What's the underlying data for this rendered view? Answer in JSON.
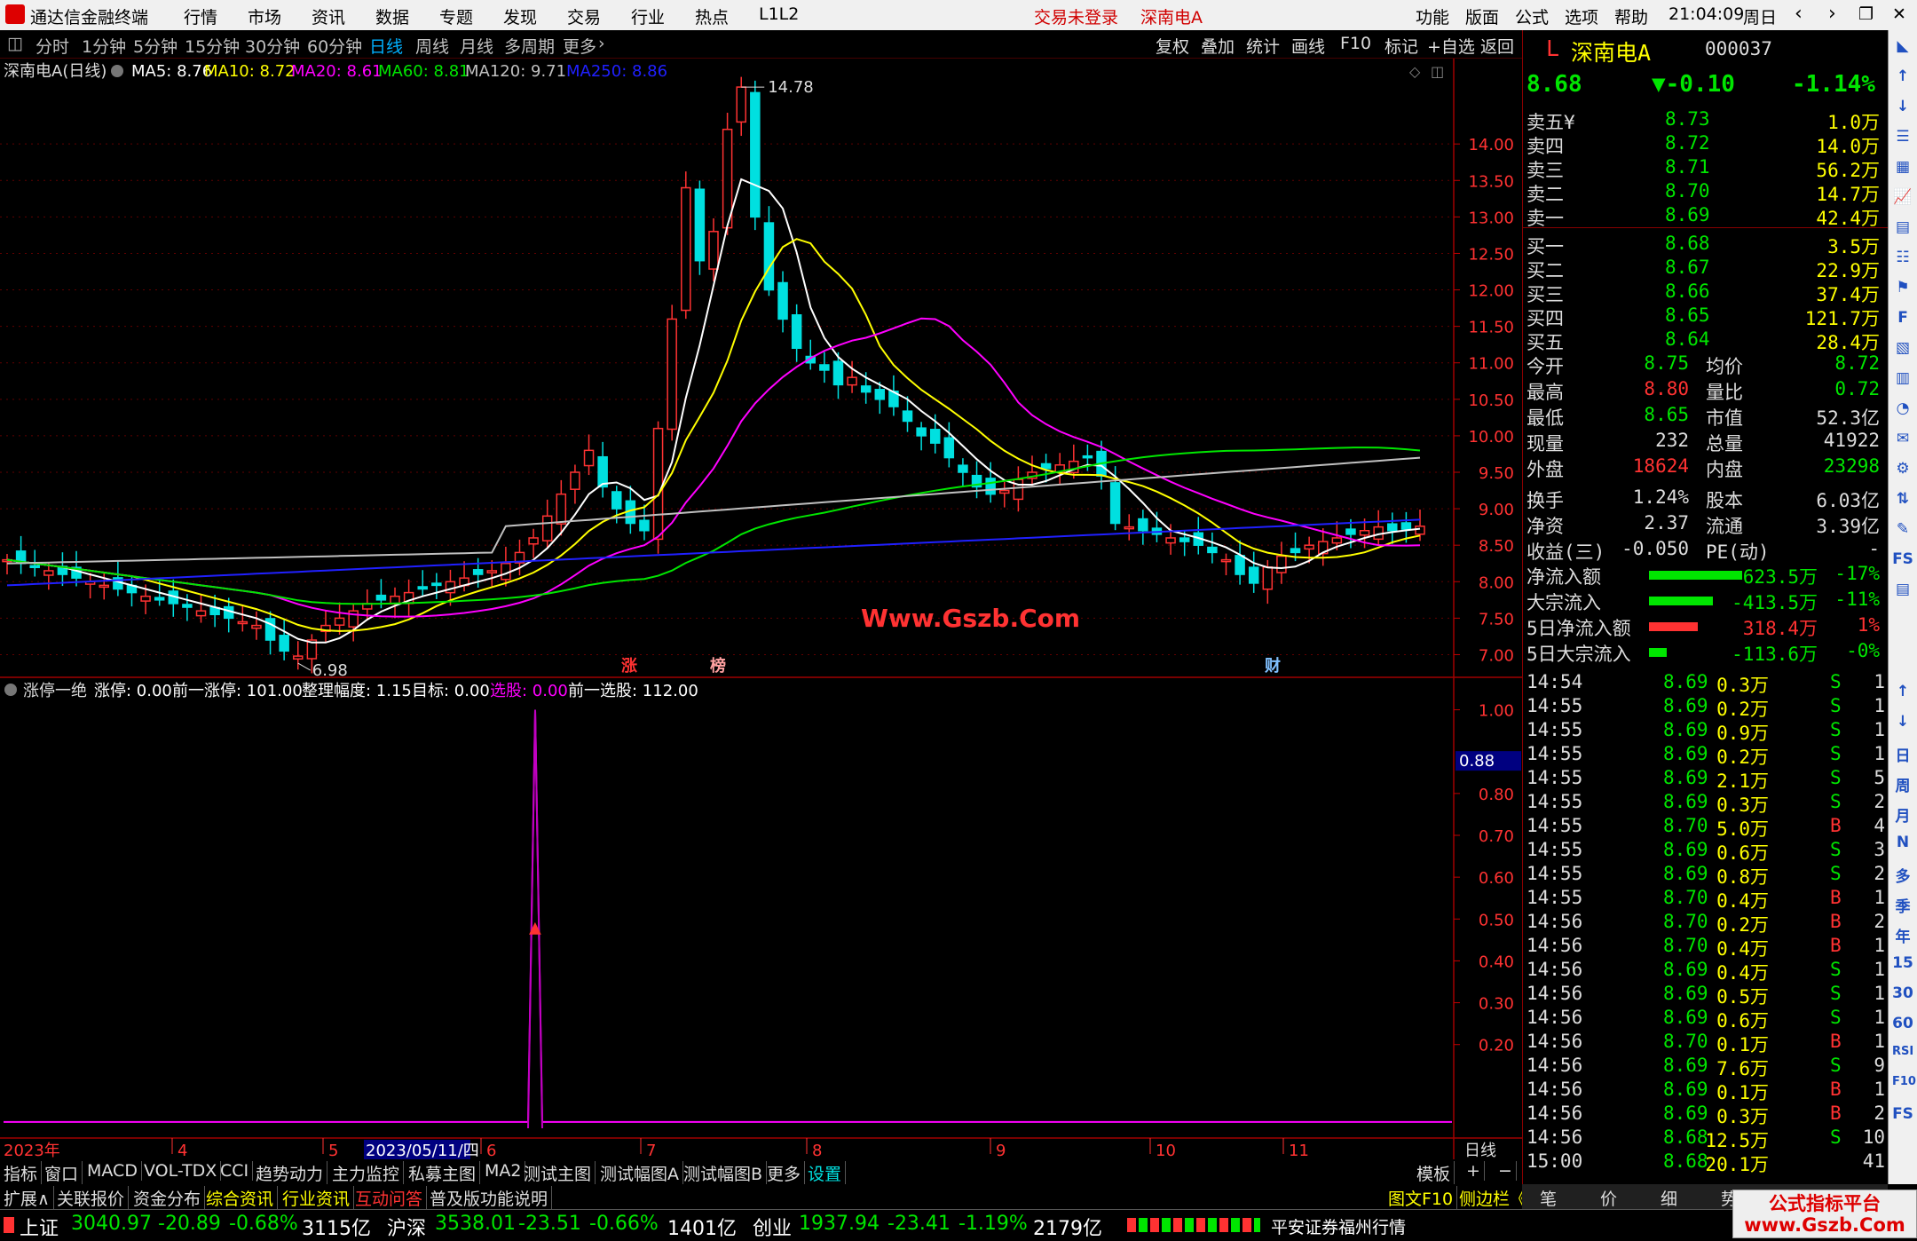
{
  "app": {
    "title": "通达信金融终端",
    "menus": [
      "行情",
      "市场",
      "资讯",
      "数据",
      "专题",
      "发现",
      "交易",
      "行业",
      "热点",
      "L1L2"
    ],
    "login": "交易未登录",
    "stock_tag": "深南电A",
    "right_menus": [
      "功能",
      "版面",
      "公式",
      "选项",
      "帮助"
    ],
    "time": "21:04:09",
    "weekday": "周日"
  },
  "periods": [
    "分时",
    "1分钟",
    "5分钟",
    "15分钟",
    "30分钟",
    "60分钟",
    "日线",
    "周线",
    "月线",
    "多周期",
    "更多"
  ],
  "active_period": "日线",
  "tools": [
    "复权",
    "叠加",
    "统计",
    "画线",
    "F10",
    "标记",
    "+自选",
    "返回"
  ],
  "ma_legend": {
    "title": "深南电A(日线)",
    "items": [
      {
        "label": "MA5: 8.76",
        "color": "#ffffff"
      },
      {
        "label": "MA10: 8.72",
        "color": "#ffff00"
      },
      {
        "label": "MA20: 8.61",
        "color": "#ff00ff"
      },
      {
        "label": "MA60: 8.81",
        "color": "#00e600"
      },
      {
        "label": "MA120: 9.71",
        "color": "#c0c0c0"
      },
      {
        "label": "MA250: 8.86",
        "color": "#2020ff"
      }
    ]
  },
  "watermark": "Www.Gszb.Com",
  "markers": [
    "涨",
    "榜",
    "财"
  ],
  "high_label": "14.78",
  "low_label": "6.98",
  "indicator_legend": {
    "name": "涨停一绝",
    "items": [
      {
        "label": "涨停: 0.00",
        "color": "#ffffff"
      },
      {
        "label": "前一涨停: 101.00",
        "color": "#ffffff"
      },
      {
        "label": "整理幅度: 1.15",
        "color": "#ffffff"
      },
      {
        "label": "目标: 0.00",
        "color": "#ffffff"
      },
      {
        "label": "选股: 0.00",
        "color": "#ff00ff"
      },
      {
        "label": "前一选股: 112.00",
        "color": "#ffffff"
      }
    ]
  },
  "current_value_tag": "0.88",
  "date_axis": {
    "labels": [
      "2023年",
      "4",
      "5",
      "2023/05/11/四",
      "6",
      "7",
      "8",
      "9",
      "10",
      "11"
    ],
    "right": "日线"
  },
  "chart_data": {
    "type": "candlestick",
    "price_axis": {
      "ticks": [
        "14.00",
        "13.50",
        "13.00",
        "12.50",
        "12.00",
        "11.50",
        "11.00",
        "10.50",
        "10.00",
        "9.50",
        "9.00",
        "8.50",
        "8.00",
        "7.50",
        "7.00"
      ],
      "ylim": [
        6.75,
        15.0
      ]
    },
    "indicator_axis": {
      "ticks": [
        "1.00",
        "0.80",
        "0.70",
        "0.60",
        "0.50",
        "0.40",
        "0.30",
        "0.20"
      ]
    },
    "daily_close": [
      8.3,
      8.25,
      8.2,
      8.15,
      8.1,
      8.05,
      8.0,
      7.95,
      7.9,
      7.85,
      7.8,
      7.75,
      7.7,
      7.65,
      7.6,
      7.55,
      7.5,
      7.45,
      7.4,
      7.2,
      7.05,
      6.98,
      7.2,
      7.4,
      7.5,
      7.6,
      7.7,
      7.75,
      7.8,
      7.85,
      7.9,
      7.95,
      8.0,
      8.05,
      8.1,
      8.15,
      8.25,
      8.4,
      8.6,
      8.9,
      9.2,
      9.5,
      9.8,
      9.3,
      9.0,
      8.8,
      8.7,
      10.1,
      11.6,
      13.4,
      12.4,
      12.8,
      14.2,
      14.78,
      13.0,
      12.0,
      11.6,
      11.2,
      11.0,
      10.9,
      10.7,
      10.8,
      10.6,
      10.5,
      10.4,
      10.2,
      10.0,
      9.9,
      9.7,
      9.5,
      9.3,
      9.2,
      9.25,
      9.4,
      9.5,
      9.55,
      9.6,
      9.65,
      9.7,
      9.45,
      8.8,
      8.75,
      8.7,
      8.65,
      8.6,
      8.55,
      8.5,
      8.4,
      8.3,
      8.1,
      7.98,
      8.2,
      8.35,
      8.4,
      8.5,
      8.55,
      8.6,
      8.65,
      8.7,
      8.75,
      8.7,
      8.72,
      8.76
    ],
    "series": [
      {
        "name": "MA5",
        "color": "#ffffff"
      },
      {
        "name": "MA10",
        "color": "#ffff00"
      },
      {
        "name": "MA20",
        "color": "#ff00ff"
      },
      {
        "name": "MA60",
        "color": "#00e600"
      },
      {
        "name": "MA120",
        "color": "#c0c0c0"
      },
      {
        "name": "MA250",
        "color": "#2020ff"
      }
    ],
    "indicator_spike": {
      "value": 1.0,
      "arrow_value": 0.48,
      "date_label": "2023/05/11/四"
    }
  },
  "quote": {
    "code_prefix": "L",
    "name": "深南电A",
    "code": "000037",
    "price": "8.68",
    "change": "▼-0.10",
    "pct": "-1.14%",
    "asks": [
      {
        "label": "卖五",
        "p": "8.73",
        "v": "1.0万"
      },
      {
        "label": "卖四",
        "p": "8.72",
        "v": "14.0万"
      },
      {
        "label": "卖三",
        "p": "8.71",
        "v": "56.2万"
      },
      {
        "label": "卖二",
        "p": "8.70",
        "v": "14.7万"
      },
      {
        "label": "卖一",
        "p": "8.69",
        "v": "42.4万"
      }
    ],
    "ask_currency": "¥",
    "bids": [
      {
        "label": "买一",
        "p": "8.68",
        "v": "3.5万"
      },
      {
        "label": "买二",
        "p": "8.67",
        "v": "22.9万"
      },
      {
        "label": "买三",
        "p": "8.66",
        "v": "37.4万"
      },
      {
        "label": "买四",
        "p": "8.65",
        "v": "121.7万"
      },
      {
        "label": "买五",
        "p": "8.64",
        "v": "28.4万"
      }
    ],
    "stats": [
      [
        "今开",
        "8.75",
        "均价",
        "8.72"
      ],
      [
        "最高",
        "8.80",
        "量比",
        "0.72"
      ],
      [
        "最低",
        "8.65",
        "市值",
        "52.3亿"
      ],
      [
        "现量",
        "232",
        "总量",
        "41922"
      ],
      [
        "外盘",
        "18624",
        "内盘",
        "23298"
      ],
      [
        "换手",
        "1.24%",
        "股本",
        "6.03亿"
      ],
      [
        "净资",
        "2.37",
        "流通",
        "3.39亿"
      ],
      [
        "收益(三)",
        "-0.050",
        "PE(动)",
        "-"
      ]
    ],
    "flows": [
      {
        "label": "净流入额",
        "v": "-623.5万",
        "p": "-17%",
        "fill": 0.95,
        "color": "#00e600"
      },
      {
        "label": "大宗流入",
        "v": "-413.5万",
        "p": "-11%",
        "fill": 0.65,
        "color": "#00e600"
      },
      {
        "label": "5日净流入额",
        "v": "318.4万",
        "p": "1%",
        "fill": 0.5,
        "color": "#ff3232"
      },
      {
        "label": "5日大宗流入",
        "v": "-113.6万",
        "p": "-0%",
        "fill": 0.18,
        "color": "#00e600"
      }
    ],
    "ticks": [
      [
        "14:54",
        "8.69",
        "0.3万",
        "S",
        "1"
      ],
      [
        "14:55",
        "8.69",
        "0.2万",
        "S",
        "1"
      ],
      [
        "14:55",
        "8.69",
        "0.9万",
        "S",
        "1"
      ],
      [
        "14:55",
        "8.69",
        "0.2万",
        "S",
        "1"
      ],
      [
        "14:55",
        "8.69",
        "2.1万",
        "S",
        "5"
      ],
      [
        "14:55",
        "8.69",
        "0.3万",
        "S",
        "2"
      ],
      [
        "14:55",
        "8.70",
        "5.0万",
        "B",
        "4"
      ],
      [
        "14:55",
        "8.69",
        "0.6万",
        "S",
        "3"
      ],
      [
        "14:55",
        "8.69",
        "0.8万",
        "S",
        "2"
      ],
      [
        "14:55",
        "8.70",
        "0.4万",
        "B",
        "1"
      ],
      [
        "14:56",
        "8.70",
        "0.2万",
        "B",
        "2"
      ],
      [
        "14:56",
        "8.70",
        "0.4万",
        "B",
        "1"
      ],
      [
        "14:56",
        "8.69",
        "0.4万",
        "S",
        "1"
      ],
      [
        "14:56",
        "8.69",
        "0.5万",
        "S",
        "1"
      ],
      [
        "14:56",
        "8.69",
        "0.6万",
        "S",
        "1"
      ],
      [
        "14:56",
        "8.70",
        "0.1万",
        "B",
        "1"
      ],
      [
        "14:56",
        "8.69",
        "7.6万",
        "S",
        "9"
      ],
      [
        "14:56",
        "8.69",
        "0.1万",
        "B",
        "1"
      ],
      [
        "14:56",
        "8.69",
        "0.3万",
        "B",
        "2"
      ],
      [
        "14:56",
        "8.68",
        "12.5万",
        "S",
        "10"
      ],
      [
        "15:00",
        "8.68",
        "20.1万",
        "",
        "41"
      ]
    ]
  },
  "sidebar_icons": [
    "↑",
    "↓",
    "日",
    "周",
    "月",
    "N",
    "多",
    "季",
    "年",
    "15",
    "30",
    "60",
    "RSI",
    "F10",
    "FS"
  ],
  "bottom_tabs1": [
    "指标",
    "窗口",
    "MACD",
    "VOL-TDX",
    "CCI",
    "趋势动力",
    "主力监控",
    "私募主图",
    "MA2",
    "测试主图",
    "测试幅图A",
    "测试幅图B",
    "更多",
    "设置"
  ],
  "bottom_tabs1_right": [
    "模板",
    "+",
    "−"
  ],
  "bottom_tabs2": [
    "扩展∧",
    "关联报价",
    "资金分布",
    "综合资讯",
    "行业资讯",
    "互动问答",
    "普及版功能说明"
  ],
  "bottom_tabs2_right": [
    "图文F10",
    "侧边栏《"
  ],
  "right_tabs": [
    "笔",
    "价",
    "细",
    "势"
  ],
  "status": {
    "sh": {
      "name": "上证",
      "v": "3040.97",
      "c": "-20.89",
      "p": "-0.68%",
      "amt": "3115亿"
    },
    "hs": {
      "name": "沪深",
      "v": "3538.01",
      "c": "-23.51",
      "p": "-0.66%",
      "amt": "1401亿"
    },
    "cy": {
      "name": "创业",
      "v": "1937.94",
      "c": "-23.41",
      "p": "-1.19%",
      "amt": "2179亿"
    },
    "broker": "平安证券福州行情",
    "promo": "公式指标平台\nwww.Gszb.Com"
  }
}
